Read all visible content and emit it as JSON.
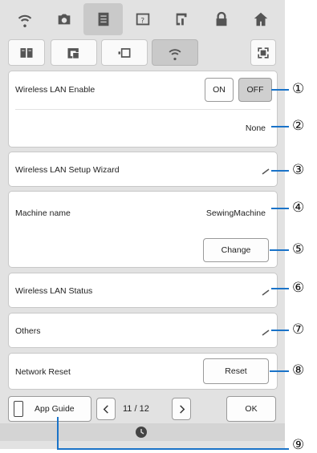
{
  "tabs": {
    "top": [
      "wifi-icon",
      "camera-icon",
      "document-icon",
      "help-icon",
      "sewing-icon",
      "lock-icon",
      "home-icon"
    ],
    "sub": [
      "book-icon",
      "machine-icon",
      "embroidery-icon",
      "wifi-icon",
      "fullscreen-icon"
    ]
  },
  "settings": {
    "wlan_enable_label": "Wireless LAN Enable",
    "on_label": "ON",
    "off_label": "OFF",
    "network_value": "None",
    "setup_wizard_label": "Wireless LAN Setup Wizard",
    "machine_name_label": "Machine name",
    "machine_name_value": "SewingMachine",
    "change_label": "Change",
    "status_label": "Wireless LAN Status",
    "others_label": "Others",
    "network_reset_label": "Network Reset",
    "reset_label": "Reset"
  },
  "footer": {
    "app_guide_label": "App Guide",
    "page_indicator": "11 / 12",
    "ok_label": "OK"
  },
  "callouts": [
    "①",
    "②",
    "③",
    "④",
    "⑤",
    "⑥",
    "⑦",
    "⑧",
    "⑨"
  ],
  "colors": {
    "accent_line": "#1a73c8",
    "active_tab": "#c9c9c9",
    "device_bg": "#e2e2e2"
  }
}
